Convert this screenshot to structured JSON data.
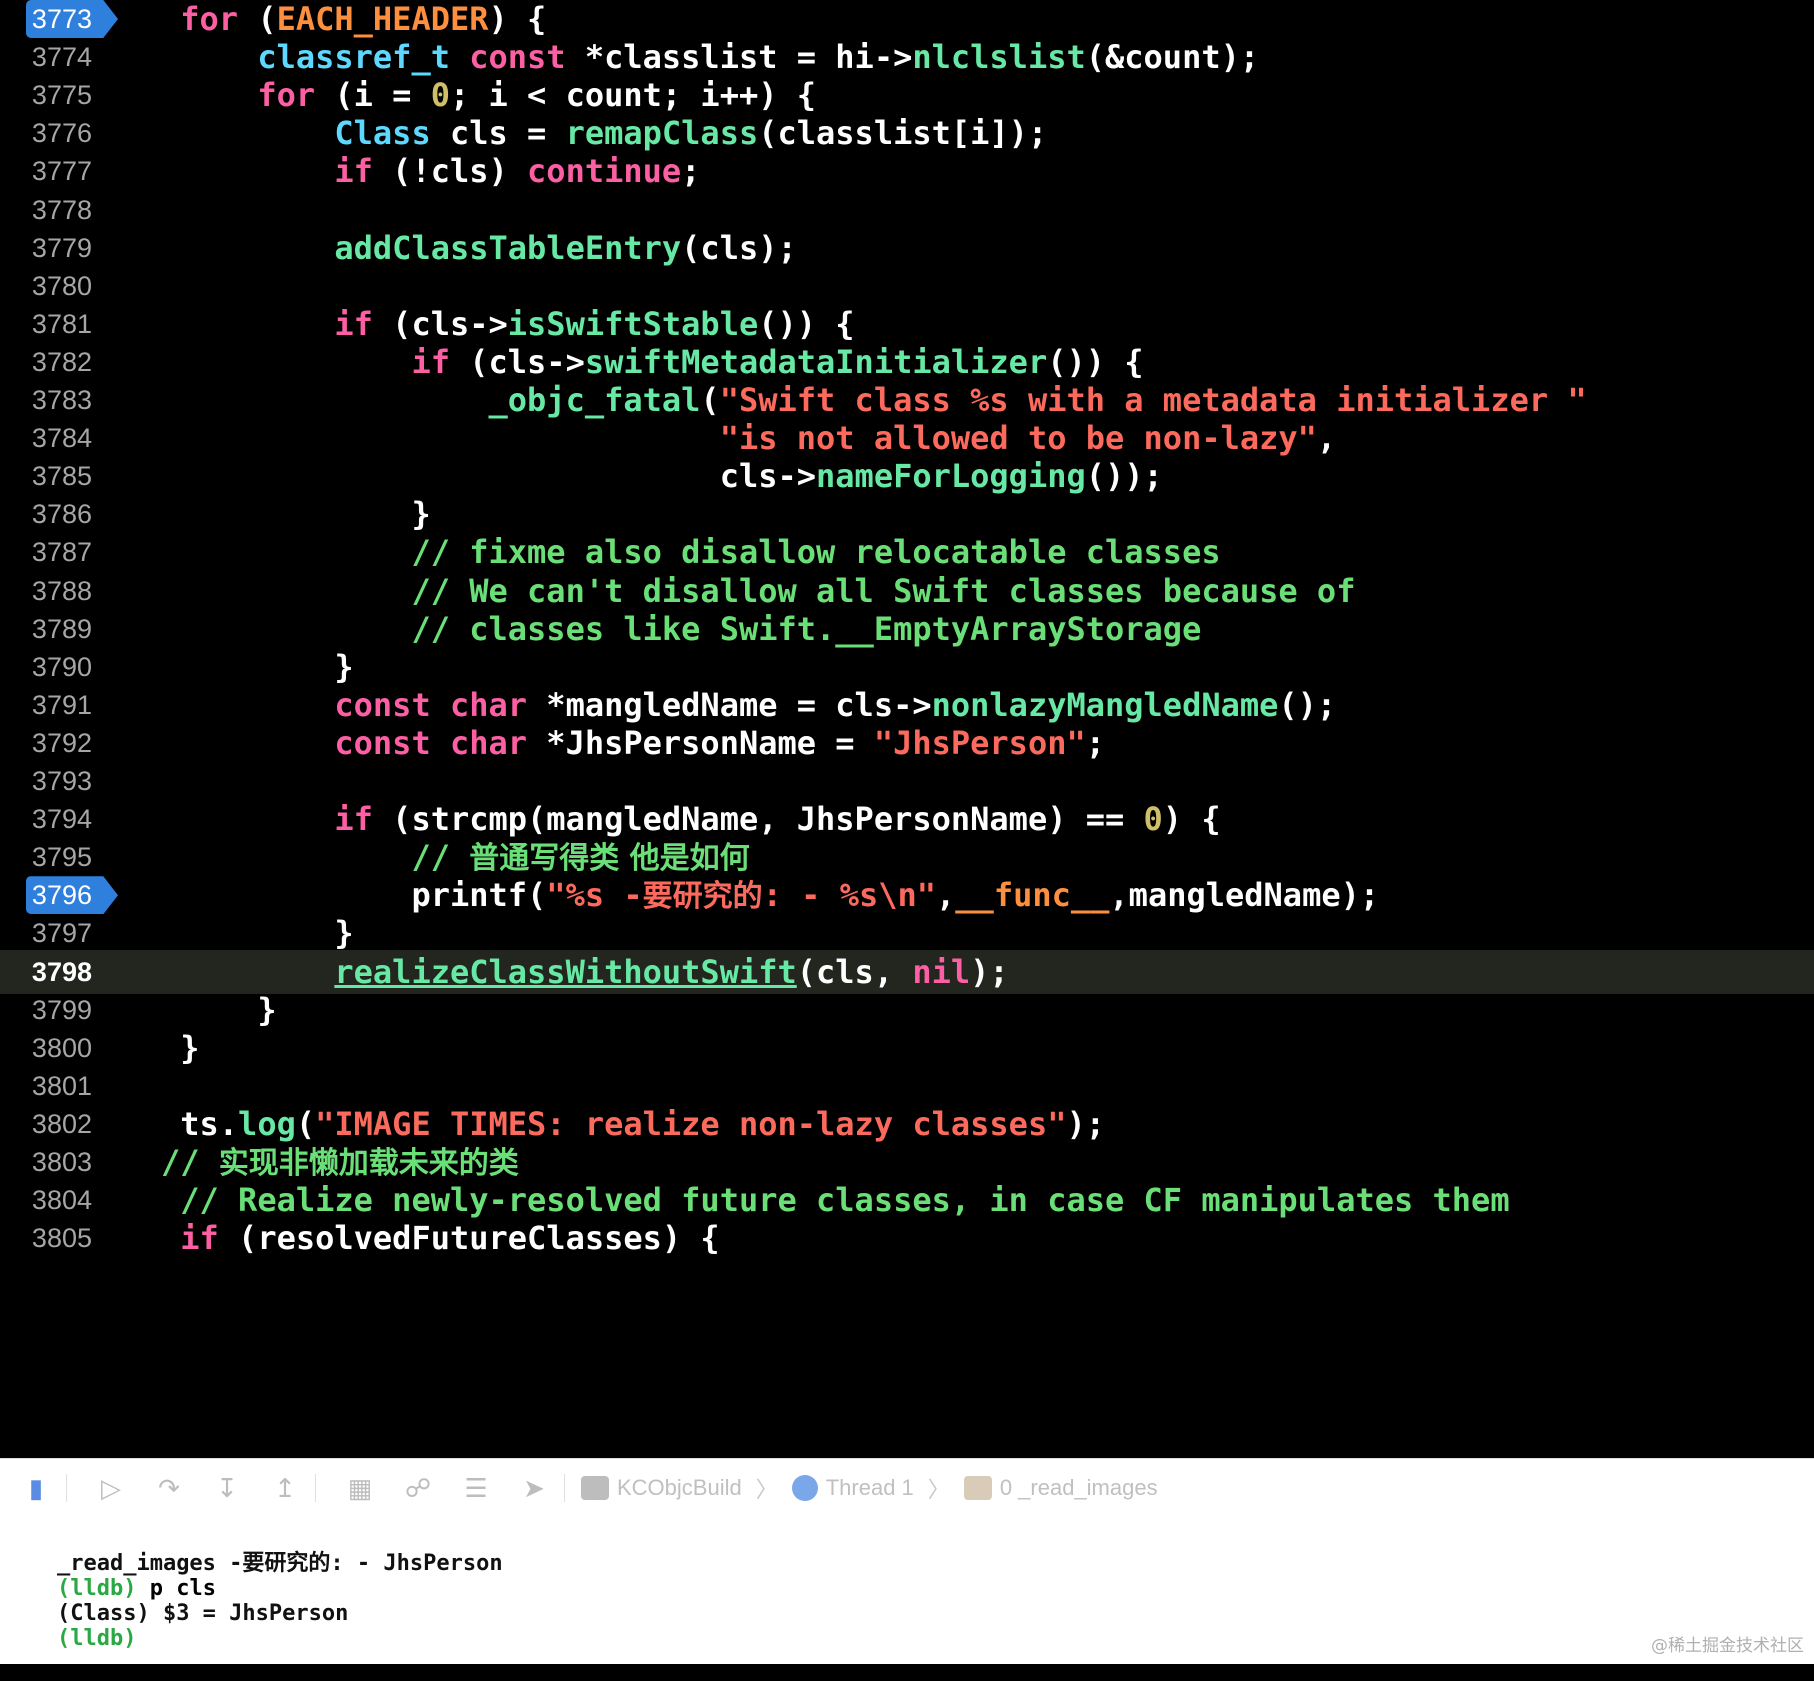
{
  "editor": {
    "highlighted_line": "3798",
    "breakpoints": [
      "3773",
      "3796"
    ],
    "lines": [
      {
        "number": "3773",
        "indent": "    ",
        "tokens": [
          {
            "t": "for",
            "c": "keyword"
          },
          {
            "t": " (",
            "c": "plain"
          },
          {
            "t": "EACH_HEADER",
            "c": "macro"
          },
          {
            "t": ") {",
            "c": "plain"
          }
        ]
      },
      {
        "number": "3774",
        "indent": "        ",
        "tokens": [
          {
            "t": "classref_t",
            "c": "type"
          },
          {
            "t": " ",
            "c": "plain"
          },
          {
            "t": "const",
            "c": "keyword"
          },
          {
            "t": " *classlist = hi->",
            "c": "plain"
          },
          {
            "t": "nlclslist",
            "c": "call"
          },
          {
            "t": "(&count);",
            "c": "plain"
          }
        ]
      },
      {
        "number": "3775",
        "indent": "        ",
        "tokens": [
          {
            "t": "for",
            "c": "keyword"
          },
          {
            "t": " (i = ",
            "c": "plain"
          },
          {
            "t": "0",
            "c": "number"
          },
          {
            "t": "; i < count; i++) {",
            "c": "plain"
          }
        ]
      },
      {
        "number": "3776",
        "indent": "            ",
        "tokens": [
          {
            "t": "Class",
            "c": "type"
          },
          {
            "t": " cls = ",
            "c": "plain"
          },
          {
            "t": "remapClass",
            "c": "call"
          },
          {
            "t": "(classlist[i]);",
            "c": "plain"
          }
        ]
      },
      {
        "number": "3777",
        "indent": "            ",
        "tokens": [
          {
            "t": "if",
            "c": "keyword"
          },
          {
            "t": " (!cls) ",
            "c": "plain"
          },
          {
            "t": "continue",
            "c": "keyword"
          },
          {
            "t": ";",
            "c": "plain"
          }
        ]
      },
      {
        "number": "3778",
        "indent": "",
        "tokens": []
      },
      {
        "number": "3779",
        "indent": "            ",
        "tokens": [
          {
            "t": "addClassTableEntry",
            "c": "call"
          },
          {
            "t": "(cls);",
            "c": "plain"
          }
        ]
      },
      {
        "number": "3780",
        "indent": "",
        "tokens": []
      },
      {
        "number": "3781",
        "indent": "            ",
        "tokens": [
          {
            "t": "if",
            "c": "keyword"
          },
          {
            "t": " (cls->",
            "c": "plain"
          },
          {
            "t": "isSwiftStable",
            "c": "call"
          },
          {
            "t": "()) {",
            "c": "plain"
          }
        ]
      },
      {
        "number": "3782",
        "indent": "                ",
        "tokens": [
          {
            "t": "if",
            "c": "keyword"
          },
          {
            "t": " (cls->",
            "c": "plain"
          },
          {
            "t": "swiftMetadataInitializer",
            "c": "call"
          },
          {
            "t": "()) {",
            "c": "plain"
          }
        ]
      },
      {
        "number": "3783",
        "indent": "                    ",
        "tokens": [
          {
            "t": "_objc_fatal",
            "c": "call"
          },
          {
            "t": "(",
            "c": "plain"
          },
          {
            "t": "\"Swift class %s with a metadata initializer \"",
            "c": "string"
          }
        ]
      },
      {
        "number": "3784",
        "indent": "                                ",
        "tokens": [
          {
            "t": "\"is not allowed to be non-lazy\"",
            "c": "string"
          },
          {
            "t": ",",
            "c": "plain"
          }
        ]
      },
      {
        "number": "3785",
        "indent": "                                ",
        "tokens": [
          {
            "t": "cls->",
            "c": "plain"
          },
          {
            "t": "nameForLogging",
            "c": "call"
          },
          {
            "t": "());",
            "c": "plain"
          }
        ]
      },
      {
        "number": "3786",
        "indent": "                ",
        "tokens": [
          {
            "t": "}",
            "c": "plain"
          }
        ]
      },
      {
        "number": "3787",
        "indent": "                ",
        "tokens": [
          {
            "t": "// fixme also disallow relocatable classes",
            "c": "comment"
          }
        ]
      },
      {
        "number": "3788",
        "indent": "                ",
        "tokens": [
          {
            "t": "// We can't disallow all Swift classes because of",
            "c": "comment"
          }
        ]
      },
      {
        "number": "3789",
        "indent": "                ",
        "tokens": [
          {
            "t": "// classes like Swift.__EmptyArrayStorage",
            "c": "comment"
          }
        ]
      },
      {
        "number": "3790",
        "indent": "            ",
        "tokens": [
          {
            "t": "}",
            "c": "plain"
          }
        ]
      },
      {
        "number": "3791",
        "indent": "            ",
        "tokens": [
          {
            "t": "const",
            "c": "keyword"
          },
          {
            "t": " ",
            "c": "plain"
          },
          {
            "t": "char",
            "c": "keyword"
          },
          {
            "t": " *mangledName = cls->",
            "c": "plain"
          },
          {
            "t": "nonlazyMangledName",
            "c": "call"
          },
          {
            "t": "();",
            "c": "plain"
          }
        ]
      },
      {
        "number": "3792",
        "indent": "            ",
        "tokens": [
          {
            "t": "const",
            "c": "keyword"
          },
          {
            "t": " ",
            "c": "plain"
          },
          {
            "t": "char",
            "c": "keyword"
          },
          {
            "t": " *JhsPersonName = ",
            "c": "plain"
          },
          {
            "t": "\"JhsPerson\"",
            "c": "string"
          },
          {
            "t": ";",
            "c": "plain"
          }
        ]
      },
      {
        "number": "3793",
        "indent": "",
        "tokens": []
      },
      {
        "number": "3794",
        "indent": "            ",
        "tokens": [
          {
            "t": "if",
            "c": "keyword"
          },
          {
            "t": " (strcmp(mangledName, JhsPersonName) == ",
            "c": "plain"
          },
          {
            "t": "0",
            "c": "number"
          },
          {
            "t": ") {",
            "c": "plain"
          }
        ]
      },
      {
        "number": "3795",
        "indent": "                ",
        "tokens": [
          {
            "t": "// ",
            "c": "comment"
          },
          {
            "t": "普通写得类 他是如何",
            "c": "comment cjk"
          }
        ]
      },
      {
        "number": "3796",
        "indent": "                ",
        "tokens": [
          {
            "t": "printf(",
            "c": "plain"
          },
          {
            "t": "\"%s -",
            "c": "string"
          },
          {
            "t": "要研究的",
            "c": "string cjk"
          },
          {
            "t": ": - %s\\n\"",
            "c": "string"
          },
          {
            "t": ",",
            "c": "plain"
          },
          {
            "t": "__func__",
            "c": "macro"
          },
          {
            "t": ",mangledName);",
            "c": "plain"
          }
        ]
      },
      {
        "number": "3797",
        "indent": "            ",
        "tokens": [
          {
            "t": "}",
            "c": "plain"
          }
        ]
      },
      {
        "number": "3798",
        "indent": "            ",
        "tokens": [
          {
            "t": "realizeClassWithoutSwift",
            "c": "call underline"
          },
          {
            "t": "(cls, ",
            "c": "plain"
          },
          {
            "t": "nil",
            "c": "keyword"
          },
          {
            "t": ");",
            "c": "plain"
          }
        ]
      },
      {
        "number": "3799",
        "indent": "        ",
        "tokens": [
          {
            "t": "}",
            "c": "plain"
          }
        ]
      },
      {
        "number": "3800",
        "indent": "    ",
        "tokens": [
          {
            "t": "}",
            "c": "plain"
          }
        ]
      },
      {
        "number": "3801",
        "indent": "",
        "tokens": []
      },
      {
        "number": "3802",
        "indent": "    ",
        "tokens": [
          {
            "t": "ts.",
            "c": "plain"
          },
          {
            "t": "log",
            "c": "call"
          },
          {
            "t": "(",
            "c": "plain"
          },
          {
            "t": "\"IMAGE TIMES: realize non-lazy classes\"",
            "c": "string"
          },
          {
            "t": ");",
            "c": "plain"
          }
        ]
      },
      {
        "number": "3803",
        "indent": "   ",
        "tokens": [
          {
            "t": "// ",
            "c": "comment"
          },
          {
            "t": "实现非懒加载未来的类",
            "c": "comment cjk"
          }
        ]
      },
      {
        "number": "3804",
        "indent": "    ",
        "tokens": [
          {
            "t": "// Realize newly-resolved future classes, in case CF manipulates them",
            "c": "comment"
          }
        ]
      },
      {
        "number": "3805",
        "indent": "    ",
        "tokens": [
          {
            "t": "if",
            "c": "keyword"
          },
          {
            "t": " (resolvedFutureClasses) {",
            "c": "plain"
          }
        ]
      }
    ]
  },
  "debug_bar": {
    "icons": [
      "toggle-console-icon",
      "continue-icon",
      "step-over-icon",
      "step-into-icon",
      "step-out-icon",
      "view-hierarchy-icon",
      "memory-graph-icon",
      "environment-overrides-icon",
      "simulate-location-icon"
    ],
    "breadcrumbs": [
      {
        "label": "KCObjcBuild",
        "icon": "target-icon"
      },
      {
        "label": "Thread 1",
        "icon": "thread-icon"
      },
      {
        "label": "0 _read_images",
        "icon": "stack-frame-icon"
      }
    ]
  },
  "console": {
    "lines": [
      {
        "prompt": "",
        "text": "_read_images -要研究的: - JhsPerson"
      },
      {
        "prompt": "(lldb)",
        "text": " p cls"
      },
      {
        "prompt": "",
        "text": "(Class) $3 = JhsPerson"
      },
      {
        "prompt": "(lldb)",
        "text": ""
      }
    ]
  },
  "watermark": "@稀土掘金技术社区",
  "colors": {
    "background": "#000000",
    "keyword": "#fc5fa3",
    "type": "#5dd8ff",
    "call": "#67e8a4",
    "string": "#fc6a5d",
    "comment": "#6bdf77",
    "number": "#d0bf69",
    "macro": "#fd8f3f",
    "breakpoint": "#2f7fdc",
    "current_line": "#22261f"
  }
}
